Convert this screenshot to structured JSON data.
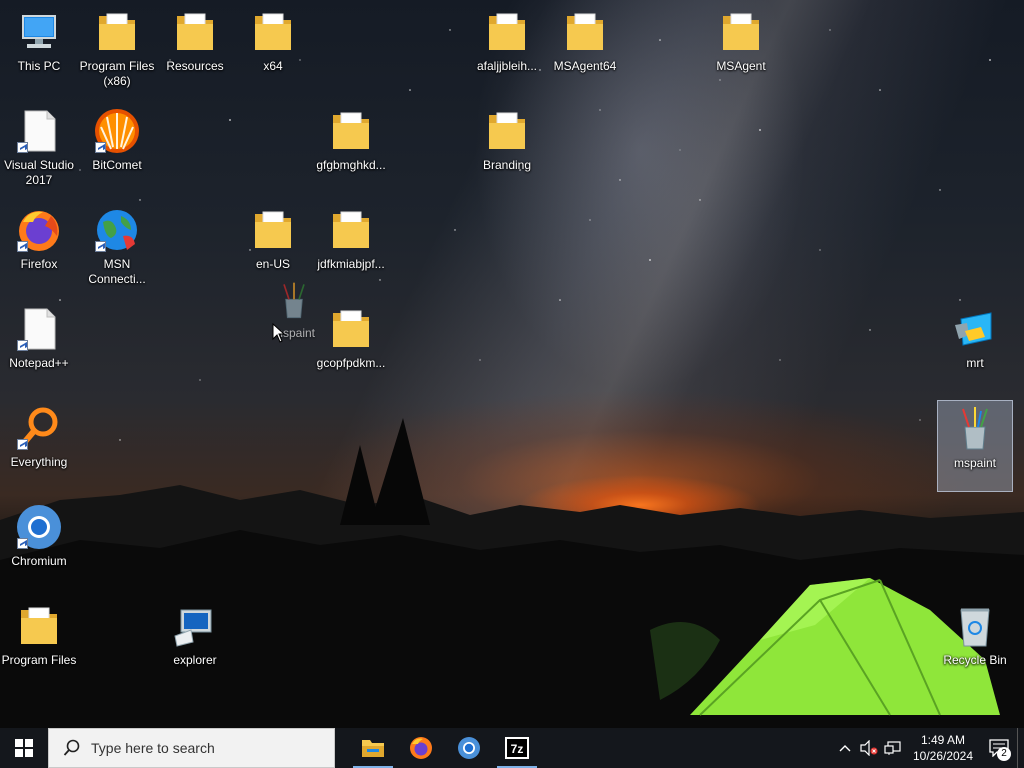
{
  "desktop_icons": {
    "this_pc": "This PC",
    "program_files_x86": "Program Files (x86)",
    "resources": "Resources",
    "x64": "x64",
    "afaljjbleih": "afaljjbleih...",
    "msagent64": "MSAgent64",
    "msagent": "MSAgent",
    "visual_studio": "Visual Studio 2017",
    "bitcomet": "BitComet",
    "gfgbmghkd": "gfgbmghkd...",
    "branding": "Branding",
    "firefox": "Firefox",
    "msn": "MSN Connecti...",
    "en_us": "en-US",
    "jdfkmiabjpf": "jdfkmiabjpf...",
    "notepadpp": "Notepad++",
    "gcopfpdkm": "gcopfpdkm...",
    "mrt": "mrt",
    "everything": "Everything",
    "mspaint": "mspaint",
    "chromium": "Chromium",
    "program_files": "Program Files",
    "explorer": "explorer",
    "recycle_bin": "Recycle Bin"
  },
  "drag_ghost": {
    "label": "mspaint"
  },
  "taskbar": {
    "search_placeholder": "Type here to search",
    "apps": [
      "File Explorer",
      "Firefox",
      "Chromium",
      "7-Zip"
    ],
    "time": "1:49 AM",
    "date": "10/26/2024",
    "notification_count": "2"
  },
  "colors": {
    "taskbar": "#14171c",
    "search_bg": "#f2f2f2",
    "folder": "#f2c14e",
    "tent": "#8fe63a",
    "accent": "#7fb2e8"
  }
}
